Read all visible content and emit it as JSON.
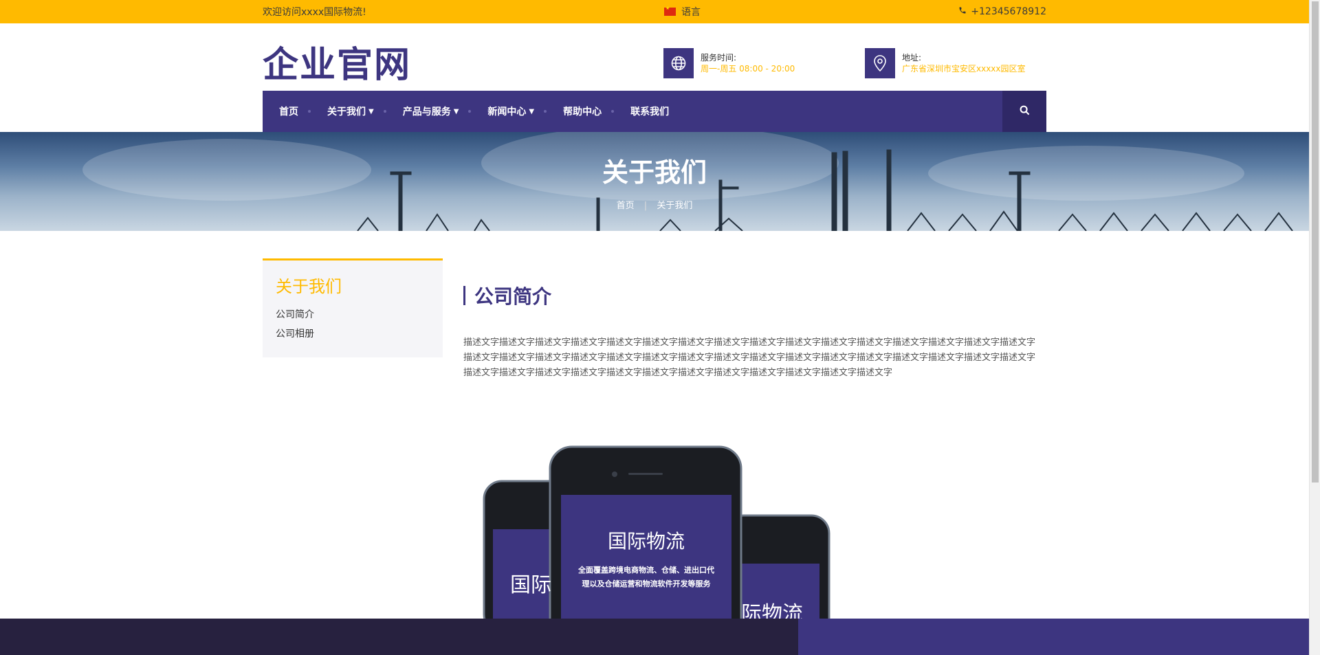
{
  "topbar": {
    "welcome": "欢迎访问xxxx国际物流!",
    "language": "语言",
    "phone": "+12345678912"
  },
  "header": {
    "logo": "企业官网",
    "service_label": "服务时间:",
    "service_value": "周一-周五 08:00 - 20:00",
    "address_label": "地址:",
    "address_value": "广东省深圳市宝安区xxxxx园区室"
  },
  "nav": {
    "items": [
      {
        "label": "首页",
        "has_dropdown": false
      },
      {
        "label": "关于我们",
        "has_dropdown": true
      },
      {
        "label": "产品与服务",
        "has_dropdown": true
      },
      {
        "label": "新闻中心",
        "has_dropdown": true
      },
      {
        "label": "帮助中心",
        "has_dropdown": false
      },
      {
        "label": "联系我们",
        "has_dropdown": false
      }
    ]
  },
  "banner": {
    "title": "关于我们",
    "breadcrumb_home": "首页",
    "breadcrumb_current": "关于我们"
  },
  "sidebar": {
    "title": "关于我们",
    "links": [
      "公司简介",
      "公司相册"
    ]
  },
  "content": {
    "title": "公司简介",
    "description": "描述文字描述文字描述文字描述文字描述文字描述文字描述文字描述文字描述文字描述文字描述文字描述文字描述文字描述文字描述文字描述文字描述文字描述文字描述文字描述文字描述文字描述文字描述文字描述文字描述文字描述文字描述文字描述文字描述文字描述文字描述文字描述文字描述文字描述文字描述文字描述文字描述文字描述文字描述文字描述文字描述文字描述文字描述文字描述文字"
  },
  "phones": {
    "center_title": "国际物流",
    "center_desc_line1": "全面覆盖跨境电商物流、仓储、进出口代",
    "center_desc_line2": "理以及仓储运营和物流软件开发等服务",
    "left_title": "国际",
    "right_title": "际物流"
  },
  "colors": {
    "brand_purple": "#3d3580",
    "accent_yellow": "#ffba00",
    "footer_dark": "#27213f"
  }
}
